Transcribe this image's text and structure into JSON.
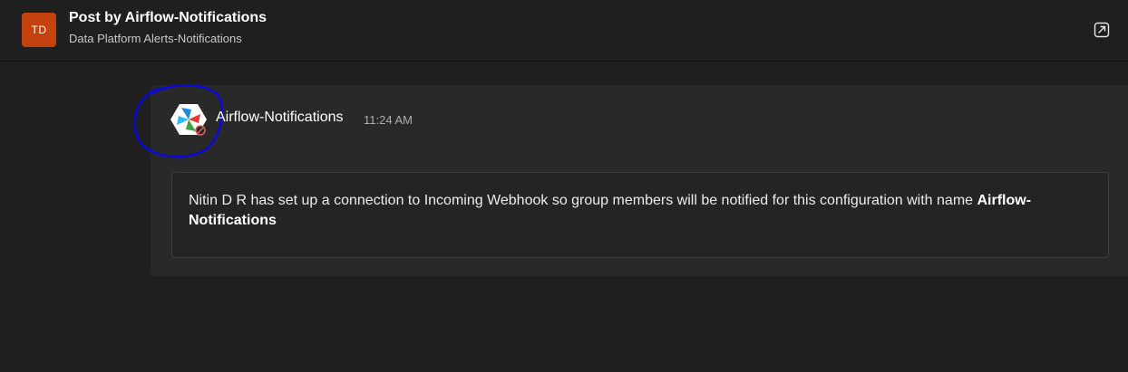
{
  "header": {
    "team_initials": "TD",
    "title": "Post by Airflow-Notifications",
    "subtitle": "Data Platform Alerts-Notifications",
    "popout_icon": "popout-icon"
  },
  "post": {
    "sender": "Airflow-Notifications",
    "timestamp": "11:24 AM",
    "avatar_icon": "airflow-logo-icon",
    "message_text": "Nitin D R has set up a connection to Incoming Webhook so group members will be notified for this configuration with name ",
    "message_bold": "Airflow-Notifications"
  },
  "colors": {
    "background": "#1f1f1f",
    "card": "#292929",
    "team_avatar": "#c4420d",
    "annotation": "#0000cc"
  }
}
